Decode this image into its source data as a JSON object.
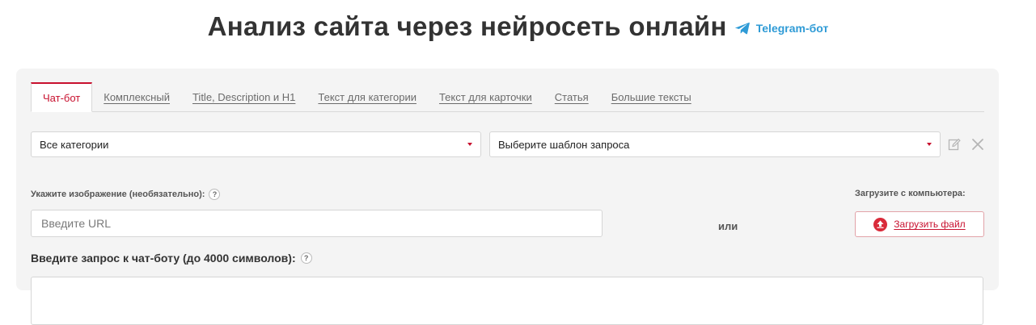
{
  "header": {
    "title": "Анализ сайта через нейросеть онлайн",
    "telegram_link": "Telegram-бот",
    "telegram_icon": "telegram-plane-icon"
  },
  "tabs": [
    {
      "label": "Чат-бот",
      "active": true
    },
    {
      "label": "Комплексный",
      "active": false
    },
    {
      "label": "Title, Description и H1",
      "active": false
    },
    {
      "label": "Текст для категории",
      "active": false
    },
    {
      "label": "Текст для карточки",
      "active": false
    },
    {
      "label": "Статья",
      "active": false
    },
    {
      "label": "Большие тексты",
      "active": false
    }
  ],
  "filters": {
    "category_select": "Все категории",
    "template_select": "Выберите шаблон запроса"
  },
  "image": {
    "label": "Укажите изображение (необязательно):",
    "help": "?",
    "url_placeholder": "Введите URL",
    "or_text": "или",
    "upload_label": "Загрузите с компьютера:",
    "upload_button": "Загрузить файл"
  },
  "query": {
    "label": "Введите запрос к чат-боту (до 4000 символов):",
    "help": "?"
  },
  "colors": {
    "accent": "#c8102e",
    "link": "#2f9bd6",
    "panel_bg": "#f4f4f4"
  }
}
